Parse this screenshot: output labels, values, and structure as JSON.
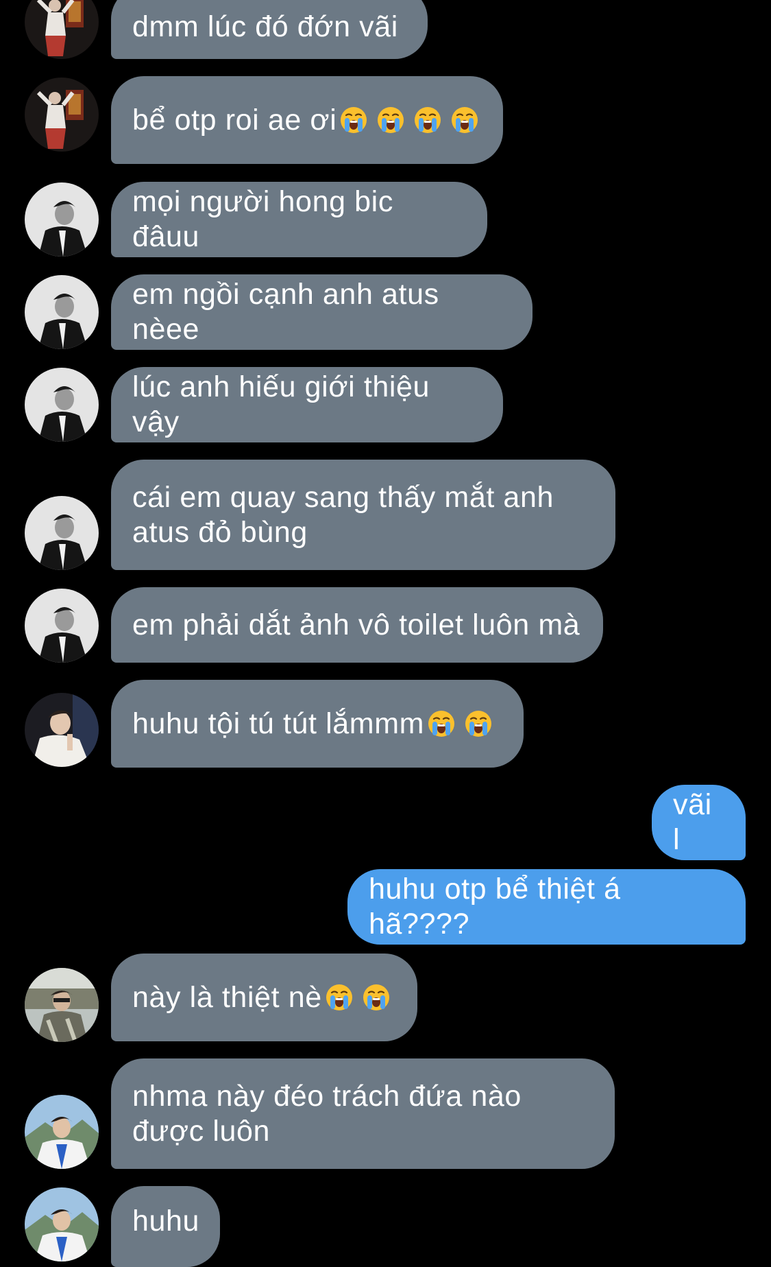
{
  "messages": [
    {
      "text": "dmm lúc đó đớn vãi",
      "emoji_count": 0
    },
    {
      "text": "bể otp roi ae ơi",
      "emoji_count": 4,
      "emoji": "loudly-crying-face"
    },
    {
      "text": "mọi người hong bic đâuu",
      "emoji_count": 0
    },
    {
      "text": "em ngồi cạnh anh atus nèee",
      "emoji_count": 0
    },
    {
      "text": "lúc anh hiếu giới thiệu vậy",
      "emoji_count": 0
    },
    {
      "text": "cái em quay sang thấy mắt anh\natus đỏ bùng",
      "emoji_count": 0
    },
    {
      "text": "em phải dắt ảnh vô toilet luôn mà",
      "emoji_count": 0
    },
    {
      "text": "huhu tội tú tút lắmmm",
      "emoji_count": 2,
      "emoji": "loudly-crying-face"
    },
    {
      "text": "vãi l",
      "emoji_count": 0
    },
    {
      "text": "huhu otp bể thiệt á hã????",
      "emoji_count": 0
    },
    {
      "text": "này là thiệt nè",
      "emoji_count": 2,
      "emoji": "loudly-crying-face"
    },
    {
      "text": "nhma này đéo trách đứa nào\nđược luôn",
      "emoji_count": 0
    },
    {
      "text": "huhu",
      "emoji_count": 0
    }
  ],
  "colors": {
    "background": "#000000",
    "incoming_bubble": "#6c7985",
    "outgoing_bubble": "#4c9eec",
    "text": "#ffffff"
  }
}
